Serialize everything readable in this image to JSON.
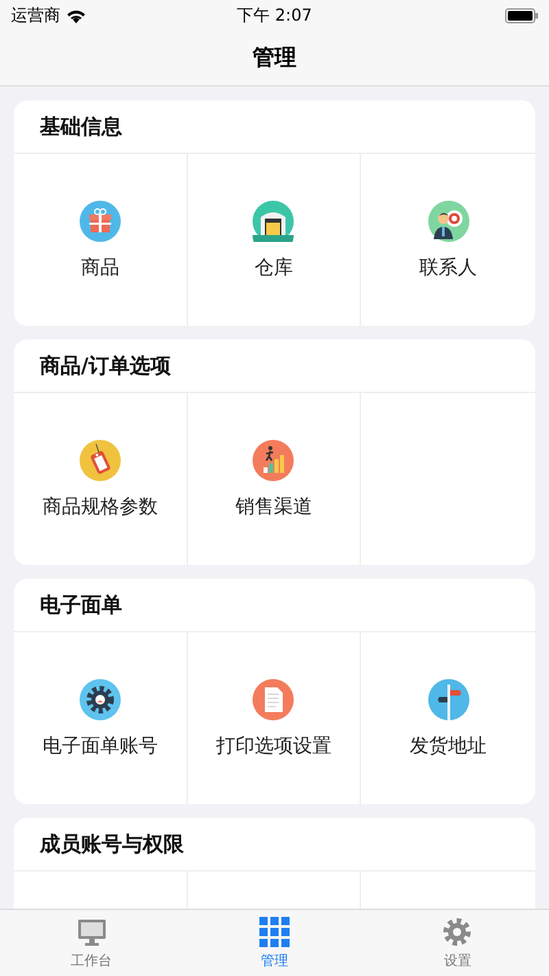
{
  "status_bar": {
    "carrier": "运营商",
    "time": "下午 2:07"
  },
  "nav_bar": {
    "title": "管理"
  },
  "sections": [
    {
      "title": "基础信息",
      "items": [
        {
          "label": "商品"
        },
        {
          "label": "仓库"
        },
        {
          "label": "联系人"
        }
      ]
    },
    {
      "title": "商品/订单选项",
      "items": [
        {
          "label": "商品规格参数"
        },
        {
          "label": "销售渠道"
        }
      ]
    },
    {
      "title": "电子面单",
      "items": [
        {
          "label": "电子面单账号"
        },
        {
          "label": "打印选项设置"
        },
        {
          "label": "发货地址"
        }
      ]
    },
    {
      "title": "成员账号与权限"
    }
  ],
  "tab_bar": [
    {
      "label": "工作台",
      "selected": false
    },
    {
      "label": "管理",
      "selected": true
    },
    {
      "label": "设置",
      "selected": false
    }
  ]
}
